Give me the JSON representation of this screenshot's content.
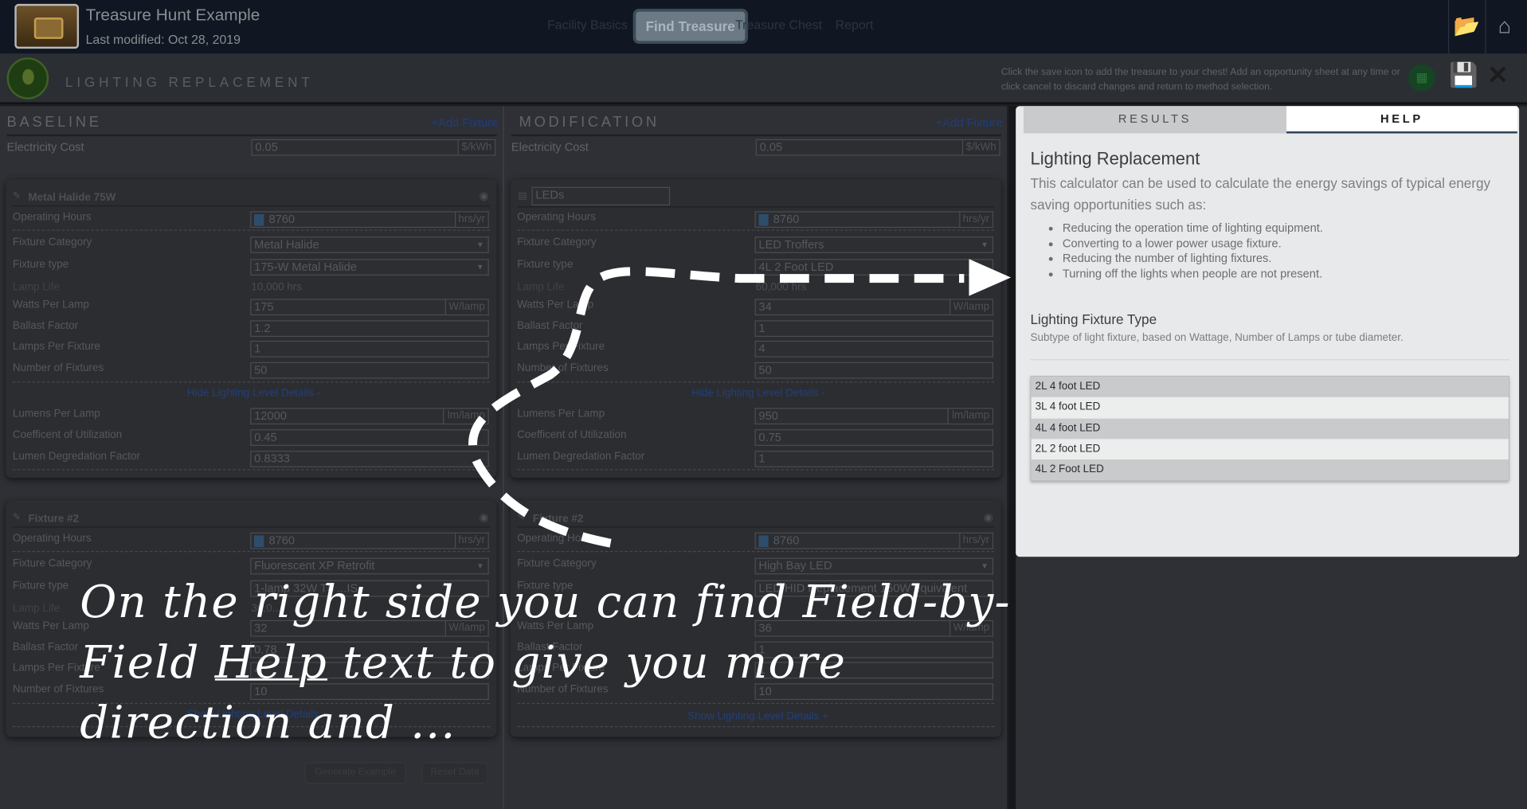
{
  "app": {
    "title": "Treasure Hunt Example",
    "modified": "Last modified: Oct 28, 2019"
  },
  "nav": {
    "tabs": [
      "Facility Basics",
      "Find Treasure",
      "Treasure Chest",
      "Report"
    ],
    "active": "Find Treasure"
  },
  "header": {
    "title": "LIGHTING REPLACEMENT",
    "message": "Click the save icon to add the treasure to your chest! Add an opportunity sheet at any time or click cancel to discard changes and return to method selection."
  },
  "baseline": {
    "title": "BASELINE",
    "add_fixture": "+Add Fixture",
    "electricity_cost_label": "Electricity Cost",
    "electricity_cost": "0.05",
    "electricity_unit": "$/kWh",
    "fixture1": {
      "name": "Metal Halide 75W",
      "operating_hours": "8760",
      "hours_unit": "hrs/yr",
      "category": "Metal Halide",
      "type": "175-W Metal Halide",
      "lamp_life": "10,000 hrs",
      "watts": "175",
      "watts_unit": "W/lamp",
      "ballast": "1.2",
      "lamps_per_fixture": "1",
      "number_of_fixtures": "50",
      "toggle": "Hide Lighting Level Details -",
      "lumens": "12000",
      "lumens_unit": "lm/lamp",
      "cu": "0.45",
      "ldf": "0.8333"
    },
    "fixture2": {
      "name": "Fixture #2",
      "operating_hours": "8760",
      "hours_unit": "hrs/yr",
      "category": "Fluorescent XP Retrofit",
      "type": "1-lamp 32W T8 ...IS",
      "lamp_life": "36,0...",
      "watts": "32",
      "watts_unit": "W/lamp",
      "ballast": "0.78",
      "lamps_per_fixture": "4",
      "number_of_fixtures": "10",
      "toggle": "Show Lighting Level Details +"
    },
    "buttons": {
      "generate": "Generate Example",
      "reset": "Reset Data"
    }
  },
  "modification": {
    "title": "MODIFICATION",
    "add_fixture": "+Add Fixture",
    "electricity_cost_label": "Electricity Cost",
    "electricity_cost": "0.05",
    "electricity_unit": "$/kWh",
    "fixture1": {
      "name": "LEDs",
      "operating_hours": "8760",
      "hours_unit": "hrs/yr",
      "category": "LED Troffers",
      "type": "4L 2 Foot LED",
      "lamp_life": "60,000 hrs",
      "watts": "34",
      "watts_unit": "W/lamp",
      "ballast": "1",
      "lamps_per_fixture": "4",
      "number_of_fixtures": "50",
      "toggle": "Hide Lighting Level Details -",
      "lumens": "950",
      "lumens_unit": "lm/lamp",
      "cu": "0.75",
      "ldf": "1"
    },
    "fixture2": {
      "name": "Fixture #2",
      "operating_hours": "8760",
      "hours_unit": "hrs/yr",
      "category": "High Bay LED",
      "type": "LED HID Replacement 150W equivalent",
      "watts": "36",
      "watts_unit": "W/lamp",
      "ballast": "1",
      "lamps_per_fixture": "1",
      "number_of_fixtures": "10",
      "toggle": "Show Lighting Level Details +"
    }
  },
  "labels": {
    "operating_hours": "Operating Hours",
    "fixture_category": "Fixture Category",
    "fixture_type": "Fixture type",
    "lamp_life": "Lamp Life",
    "watts_per_lamp": "Watts Per Lamp",
    "ballast_factor": "Ballast Factor",
    "lamps_per_fixture": "Lamps Per Fixture",
    "number_of_fixtures": "Number of Fixtures",
    "lumens_per_lamp": "Lumens Per Lamp",
    "cu": "Coefficent of Utilization",
    "ldf": "Lumen Degredation Factor"
  },
  "help_panel": {
    "tabs": [
      "RESULTS",
      "HELP"
    ],
    "title": "Lighting Replacement",
    "description": "This calculator can be used to calculate the energy savings of typical energy saving opportunities such as:",
    "bullets": [
      "Reducing the operation time of lighting equipment.",
      "Converting to a lower power usage fixture.",
      "Reducing the number of lighting fixtures.",
      "Turning off the lights when people are not present."
    ],
    "subtitle": "Lighting Fixture Type",
    "subdesc": "Subtype of light fixture, based on Wattage, Number of Lamps or tube diameter.",
    "table_rows": [
      "2L 4 foot LED",
      "3L 4 foot LED",
      "4L 4 foot LED",
      "2L 2 foot LED",
      "4L 2 Foot LED"
    ]
  },
  "overlay": {
    "line1": "On the right side you can find Field-by-",
    "line2_pre": "Field ",
    "line2_link": "Help",
    "line2_post": " text to give you more",
    "line3": "direction and ..."
  },
  "colors": {
    "topbar": "#101722",
    "panel_bg": "#e8e9ea",
    "active_tab": "#6c7a86",
    "link": "#1f3d7e"
  }
}
